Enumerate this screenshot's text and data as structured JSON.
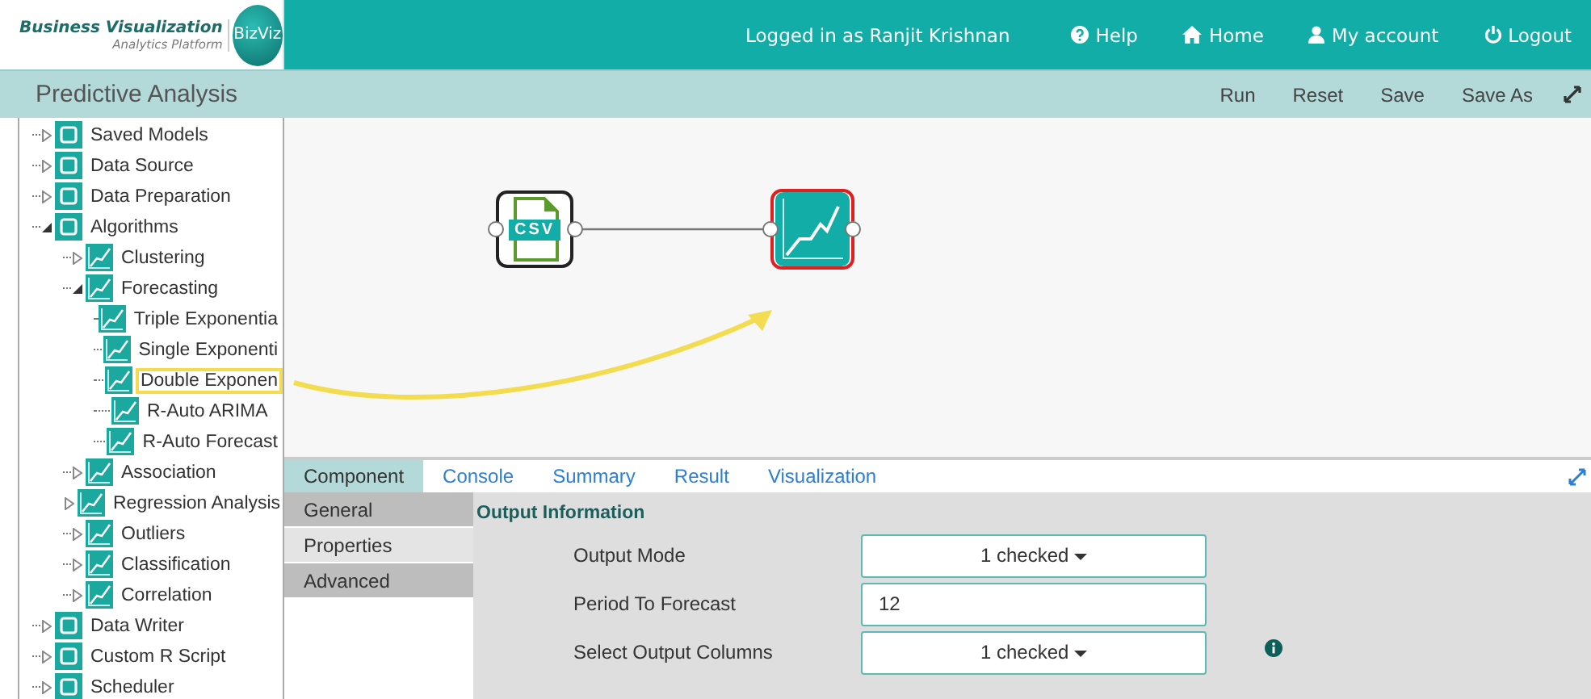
{
  "header": {
    "brand_title": "Business Visualization",
    "brand_subtitle": "Analytics Platform",
    "logo_text": "BizViz",
    "user": "Logged in as Ranjit Krishnan",
    "links": [
      {
        "kind": "help",
        "label": "Help"
      },
      {
        "kind": "home",
        "label": "Home"
      },
      {
        "kind": "account",
        "label": "My account"
      },
      {
        "kind": "logout",
        "label": "Logout"
      }
    ]
  },
  "toolbar": {
    "title": "Predictive Analysis",
    "actions": [
      "Run",
      "Reset",
      "Save",
      "Save As"
    ]
  },
  "tree": [
    {
      "label": "Saved Models",
      "expanded": false,
      "selected": false
    },
    {
      "label": "Data Source",
      "expanded": false,
      "selected": false
    },
    {
      "label": "Data Preparation",
      "expanded": false,
      "selected": false
    },
    {
      "label": "Algorithms",
      "expanded": true,
      "selected": false,
      "children": [
        {
          "label": "Clustering",
          "expanded": false,
          "selected": false
        },
        {
          "label": "Forecasting",
          "expanded": true,
          "selected": false,
          "children": [
            {
              "label": "Triple Exponentia",
              "selected": false
            },
            {
              "label": "Single Exponenti",
              "selected": false
            },
            {
              "label": "Double Exponen",
              "selected": true
            },
            {
              "label": "R-Auto ARIMA",
              "selected": false
            },
            {
              "label": "R-Auto Forecast",
              "selected": false
            }
          ]
        },
        {
          "label": "Association",
          "expanded": false,
          "selected": false
        },
        {
          "label": "Regression Analysis",
          "expanded": false,
          "selected": false
        },
        {
          "label": "Outliers",
          "expanded": false,
          "selected": false
        },
        {
          "label": "Classification",
          "expanded": false,
          "selected": false
        },
        {
          "label": "Correlation",
          "expanded": false,
          "selected": false
        }
      ]
    },
    {
      "label": "Data Writer",
      "expanded": false,
      "selected": false
    },
    {
      "label": "Custom R Script",
      "expanded": false,
      "selected": false
    },
    {
      "label": "Scheduler",
      "expanded": false,
      "selected": false
    }
  ],
  "canvas": {
    "nodes": [
      {
        "kind": "csv",
        "label": "CSV",
        "selected": false
      },
      {
        "kind": "forecast",
        "selected": true
      }
    ]
  },
  "panel": {
    "tabs": [
      {
        "label": "Component",
        "selected": true
      },
      {
        "label": "Console",
        "selected": false
      },
      {
        "label": "Summary",
        "selected": false
      },
      {
        "label": "Result",
        "selected": false
      },
      {
        "label": "Visualization",
        "selected": false
      }
    ],
    "sections": [
      {
        "label": "General",
        "selected": true
      },
      {
        "label": "Properties",
        "selected": false
      },
      {
        "label": "Advanced",
        "selected": true
      }
    ],
    "heading": "Output Information",
    "fields": [
      {
        "label": "Output Mode",
        "kind": "dropdown",
        "value": "1 checked",
        "info": false
      },
      {
        "label": "Period To Forecast",
        "kind": "input",
        "value": "12",
        "info": false
      },
      {
        "label": "Select Output Columns",
        "kind": "dropdown",
        "value": "1 checked",
        "info": true
      }
    ]
  }
}
